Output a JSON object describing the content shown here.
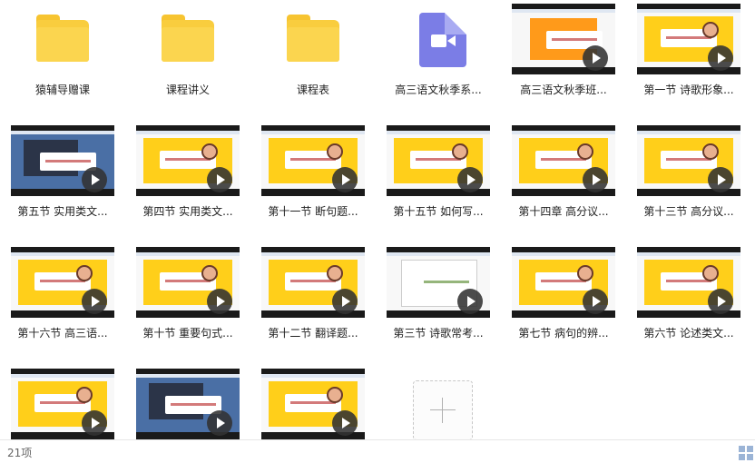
{
  "items": [
    {
      "label": "猿辅导赠课",
      "kind": "folder"
    },
    {
      "label": "课程讲义",
      "kind": "folder"
    },
    {
      "label": "课程表",
      "kind": "folder"
    },
    {
      "label": "高三语文秋季系...",
      "kind": "video-file"
    },
    {
      "label": "高三语文秋季班...",
      "kind": "video",
      "style": "orange"
    },
    {
      "label": "第一节 诗歌形象...",
      "kind": "video",
      "style": "yellow"
    },
    {
      "label": "第五节 实用类文...",
      "kind": "video",
      "style": "desktop"
    },
    {
      "label": "第四节 实用类文...",
      "kind": "video",
      "style": "yellow"
    },
    {
      "label": "第十一节 断句题...",
      "kind": "video",
      "style": "yellow"
    },
    {
      "label": "第十五节 如何写...",
      "kind": "video",
      "style": "yellow"
    },
    {
      "label": "第十四章 高分议...",
      "kind": "video",
      "style": "yellow"
    },
    {
      "label": "第十三节 高分议...",
      "kind": "video",
      "style": "yellow"
    },
    {
      "label": "第十六节 高三语...",
      "kind": "video",
      "style": "yellow"
    },
    {
      "label": "第十节 重要句式...",
      "kind": "video",
      "style": "yellow"
    },
    {
      "label": "第十二节 翻译题...",
      "kind": "video",
      "style": "yellow"
    },
    {
      "label": "第三节 诗歌常考...",
      "kind": "video",
      "style": "table"
    },
    {
      "label": "第七节 病句的辨...",
      "kind": "video",
      "style": "yellow"
    },
    {
      "label": "第六节 论述类文...",
      "kind": "video",
      "style": "yellow"
    },
    {
      "label": "",
      "kind": "video",
      "style": "yellow"
    },
    {
      "label": "",
      "kind": "video",
      "style": "desktop"
    },
    {
      "label": "",
      "kind": "video",
      "style": "yellow"
    }
  ],
  "status": {
    "item_count": "21项"
  },
  "icons": {
    "folder": "folder-icon",
    "video_file": "video-file-icon",
    "play": "play-icon",
    "add": "plus-icon",
    "grid_view": "grid-view-icon"
  },
  "colors": {
    "folder": "#f9cd3e",
    "video_file": "#7b7de6",
    "slide_yellow": "#ffcf1a"
  }
}
